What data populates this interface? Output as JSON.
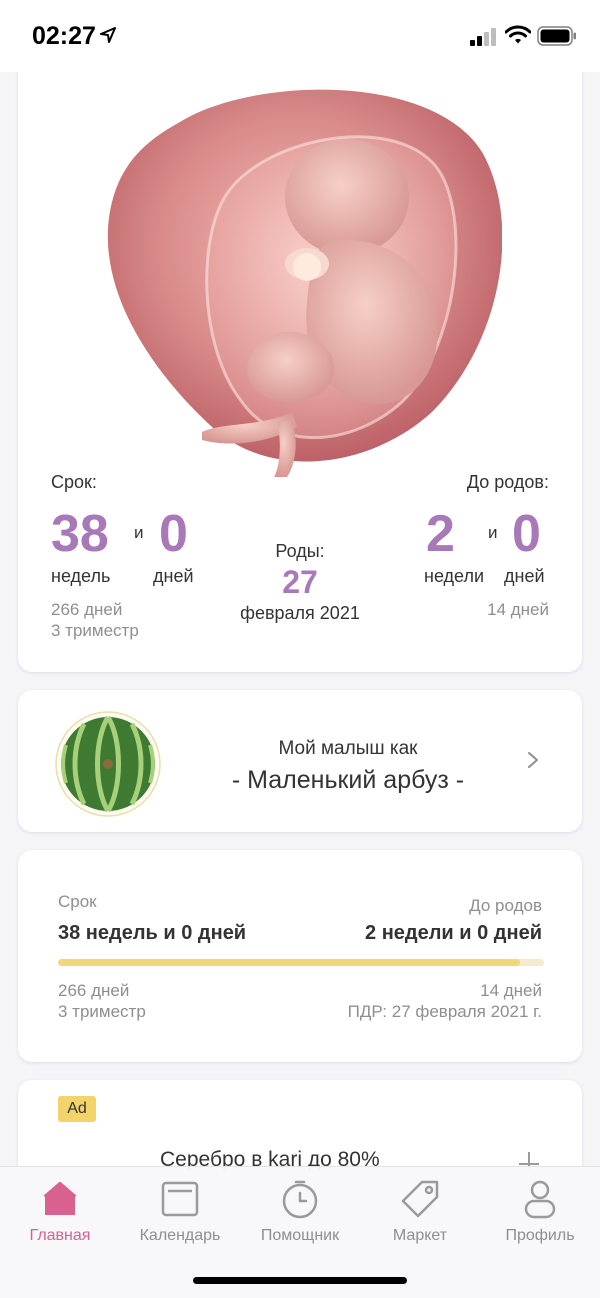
{
  "status_bar": {
    "time": "02:27"
  },
  "pregnancy": {
    "term_label": "Срок:",
    "weeks_value": "38",
    "and1": "и",
    "days_value": "0",
    "weeks_unit": "недель",
    "days_unit": "дней",
    "total_days": "266 дней",
    "trimester": "3 триместр",
    "birth_label": "Роды:",
    "birth_day": "27",
    "birth_month_year": "февраля 2021",
    "until_label": "До родов:",
    "until_weeks_value": "2",
    "and2": "и",
    "until_days_value": "0",
    "until_weeks_unit": "недели",
    "until_days_unit": "дней",
    "until_total_days": "14 дней"
  },
  "baby": {
    "line1": "Мой малыш как",
    "line2": "- Маленький арбуз -"
  },
  "progress": {
    "term_label": "Срок",
    "term_value": "38 недель и 0 дней",
    "until_label": "До родов",
    "until_value": "2 недели и 0 дней",
    "progress_fraction": 0.95,
    "total_days": "266 дней",
    "trimester": "3 триместр",
    "until_days": "14 дней",
    "due_date": "ПДР: 27 февраля 2021 г."
  },
  "ad": {
    "badge": "Ad",
    "text": "Серебро в kari до 80%"
  },
  "tabs": [
    {
      "label": "Главная",
      "icon": "home-icon",
      "active": true
    },
    {
      "label": "Календарь",
      "icon": "calendar-icon",
      "active": false
    },
    {
      "label": "Помощник",
      "icon": "clock-icon",
      "active": false
    },
    {
      "label": "Маркет",
      "icon": "tag-icon",
      "active": false
    },
    {
      "label": "Профиль",
      "icon": "profile-icon",
      "active": false
    }
  ],
  "colors": {
    "accent": "#a878b8",
    "tab_active": "#d9608f",
    "progress_fill": "#f0d77a",
    "ad_badge": "#f3d46a"
  }
}
